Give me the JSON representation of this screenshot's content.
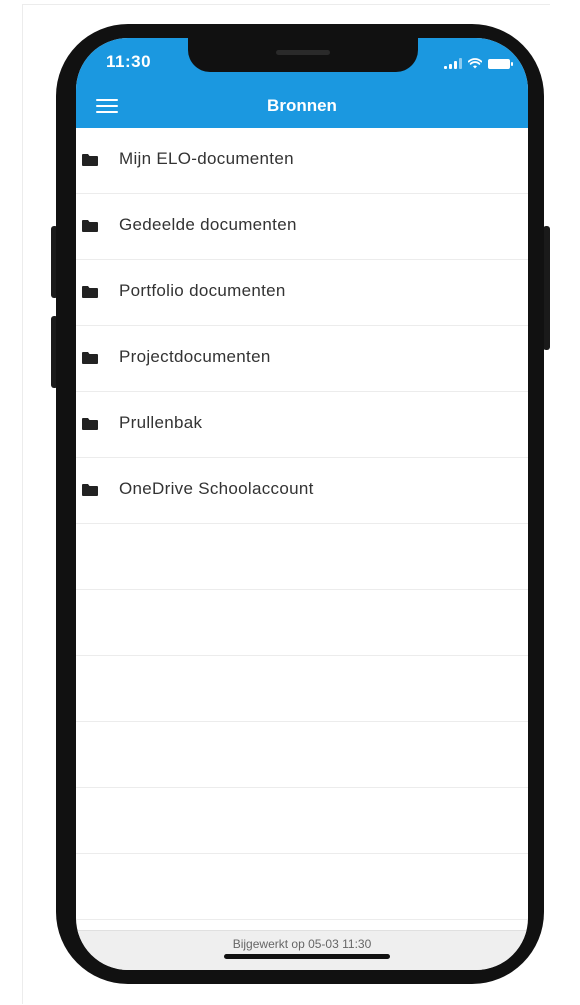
{
  "status_bar": {
    "time": "11:30",
    "icons": [
      "cellular-signal-icon",
      "wifi-icon",
      "battery-icon"
    ]
  },
  "nav_bar": {
    "title": "Bronnen",
    "menu_icon": "hamburger-menu-icon"
  },
  "colors": {
    "accent": "#1b98e0",
    "text": "#333333",
    "footer_bg": "#efefef"
  },
  "sources": {
    "item_icon": "folder-icon",
    "items": [
      {
        "label": "Mijn ELO-documenten"
      },
      {
        "label": "Gedeelde documenten"
      },
      {
        "label": "Portfolio documenten"
      },
      {
        "label": "Projectdocumenten"
      },
      {
        "label": "Prullenbak"
      },
      {
        "label": "OneDrive Schoolaccount"
      }
    ]
  },
  "footer": {
    "updated_text": "Bijgewerkt op 05-03 11:30"
  }
}
